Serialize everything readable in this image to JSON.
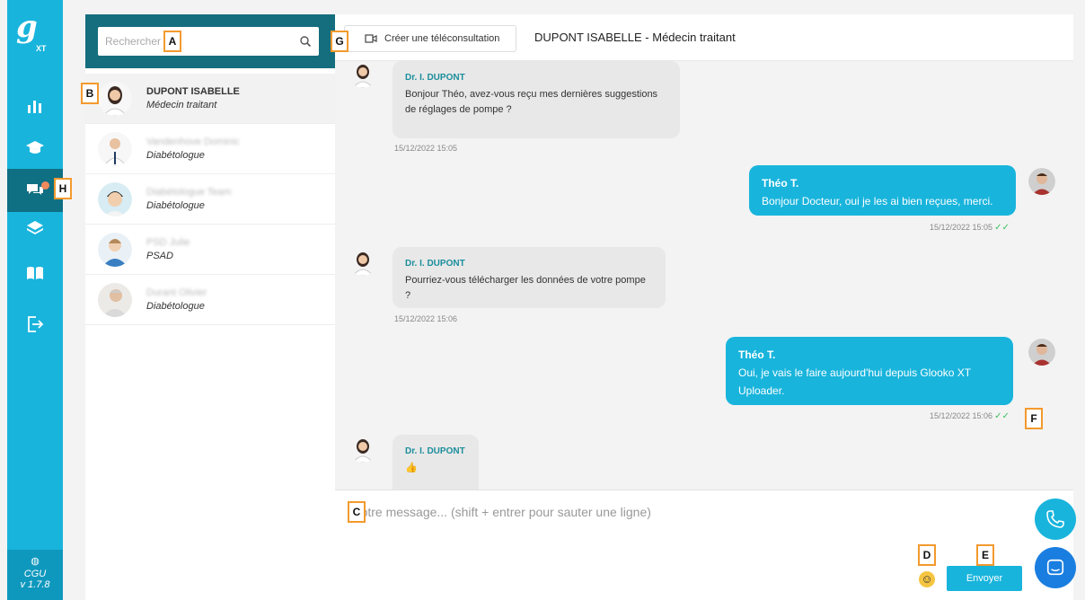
{
  "sidebar": {
    "logo_text": "g",
    "logo_sub": "XT",
    "nav_icons": [
      "bar-chart-icon",
      "graduation-cap-icon",
      "chat-icon",
      "layers-icon",
      "book-icon",
      "logout-icon"
    ],
    "active_icon": "chat-icon",
    "cgu_label": "CGU",
    "version": "v 1.7.8"
  },
  "search": {
    "placeholder": "Rechercher"
  },
  "contacts": [
    {
      "name": "DUPONT ISABELLE",
      "role": "Médecin traitant",
      "active": true
    },
    {
      "name": "Vandenhove Dominic",
      "role": "Diabétologue",
      "active": false
    },
    {
      "name": "Diabétologue Team",
      "role": "Diabétologue",
      "active": false
    },
    {
      "name": "PSD Julie",
      "role": "PSAD",
      "active": false
    },
    {
      "name": "Durant Olivier",
      "role": "Diabétologue",
      "active": false
    }
  ],
  "chat": {
    "tele_button": "Créer une téléconsultation",
    "title": "DUPONT ISABELLE - Médecin traitant",
    "messages": [
      {
        "sender": "Dr. I. DUPONT",
        "text": "Bonjour Théo, avez-vous reçu mes dernières suggestions de réglages de pompe ?",
        "time": "15/12/2022 15:05",
        "direction": "in"
      },
      {
        "sender": "Théo T.",
        "text": "Bonjour Docteur, oui je les ai bien reçues, merci.",
        "time": "15/12/2022 15:05",
        "direction": "out"
      },
      {
        "sender": "Dr. I. DUPONT",
        "text": "Pourriez-vous télécharger les données de votre pompe ?",
        "time": "15/12/2022 15:06",
        "direction": "in"
      },
      {
        "sender": "Théo T.",
        "text": "Oui, je vais le faire aujourd'hui depuis Glooko XT Uploader.",
        "time": "15/12/2022 15:06",
        "direction": "out"
      },
      {
        "sender": "Dr. I. DUPONT",
        "text": "👍",
        "time": "",
        "direction": "in"
      }
    ],
    "composer_placeholder": "Votre message... (shift + entrer pour sauter une ligne)",
    "send_label": "Envoyer"
  },
  "markers": {
    "a": "A",
    "b": "B",
    "c": "C",
    "d": "D",
    "e": "E",
    "f": "F",
    "g": "G",
    "h": "H"
  },
  "colors": {
    "sidebar": "#18b4dc",
    "sidebar_active": "#0f6f83",
    "search_header": "#146e7e",
    "bubble_out": "#18b4dc",
    "bubble_in": "#e8e8e8",
    "sender_in": "#1b8e9c",
    "marker_border": "#f39a2e"
  }
}
